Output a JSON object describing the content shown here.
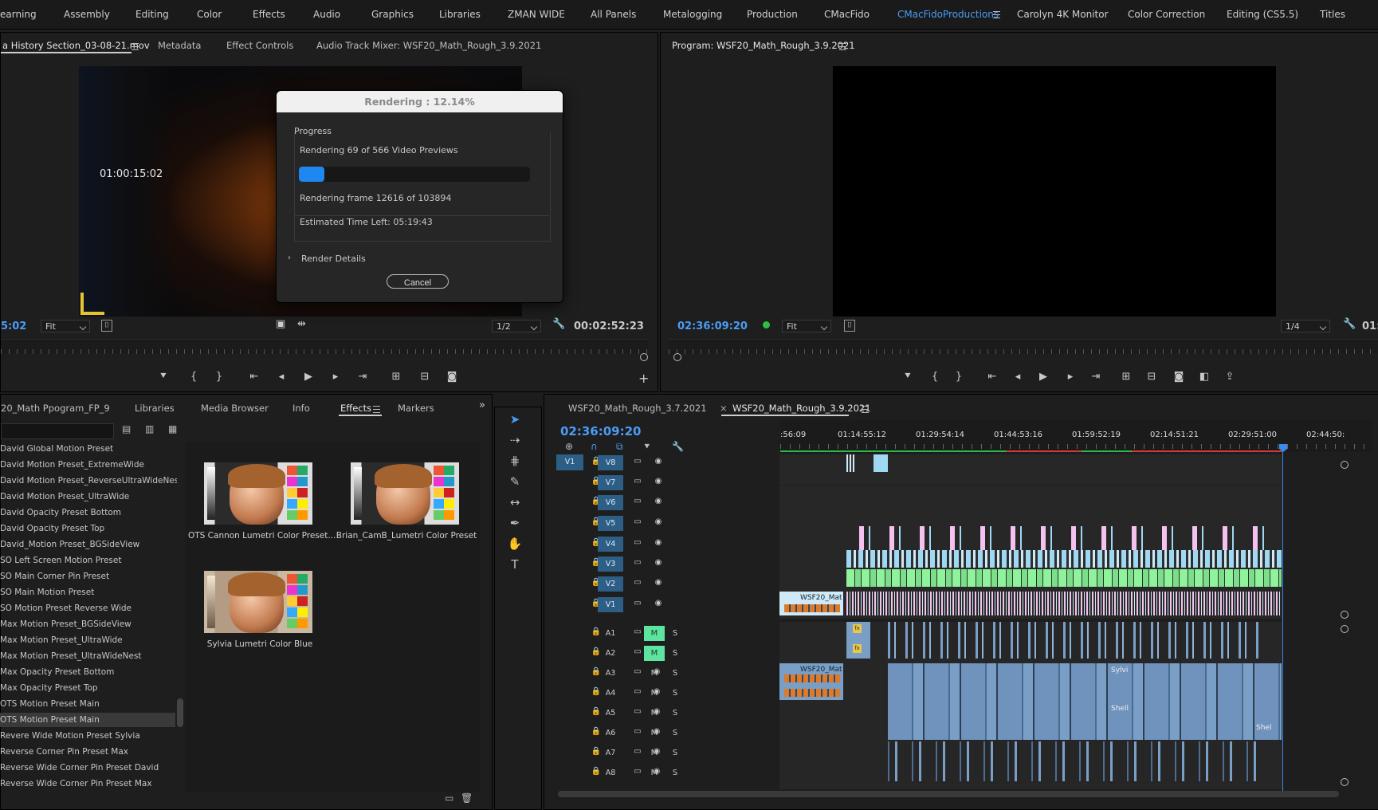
{
  "workspaces": [
    "earning",
    "Assembly",
    "Editing",
    "Color",
    "Effects",
    "Audio",
    "Graphics",
    "Libraries",
    "ZMAN WIDE",
    "All Panels",
    "Metalogging",
    "Production",
    "CMacFido",
    "CMacFidoProductions",
    "Carolyn 4K Monitor",
    "Color Correction",
    "Editing (CS5.5)",
    "Titles"
  ],
  "active_workspace": "CMacFidoProductions",
  "source_panel": {
    "tabs": [
      "a History Section_03-08-21.mov",
      "Metadata",
      "Effect Controls",
      "Audio Track Mixer: WSF20_Math_Rough_3.9.2021"
    ],
    "overlay_timecode": "01:00:15:02",
    "left_timecode": "5:02",
    "fit": "Fit",
    "resolution": "1/2",
    "duration": "00:02:52:23"
  },
  "program_panel": {
    "title": "Program: WSF20_Math_Rough_3.9.2021",
    "timecode": "02:36:09:20",
    "fit": "Fit",
    "resolution": "1/4",
    "right_timecode": "01:"
  },
  "dialog": {
    "title": "Rendering : 12.14%",
    "group_label": "Progress",
    "line1": "Rendering 69 of 566 Video Previews",
    "progress": 0.1214,
    "line2": "Rendering frame 12616 of 103894",
    "line3": "Estimated Time Left: 05:19:43",
    "details": "Render Details",
    "cancel": "Cancel"
  },
  "project_panel": {
    "tabs": [
      "20_Math Ppogram_FP_9",
      "Libraries",
      "Media Browser",
      "Info",
      "Effects",
      "Markers"
    ],
    "active_tab": "Effects",
    "presets": [
      "David Global Motion Preset",
      "David Motion Preset_ExtremeWide",
      "David Motion Preset_ReverseUltraWideNest",
      "David Motion Preset_UltraWide",
      "David Opacity Preset Bottom",
      "David Opacity Preset Top",
      "David_Motion Preset_BGSideView",
      "SO Left Screen Motion Preset",
      "SO Main Corner Pin Preset",
      "SO Main Motion Preset",
      "SO Motion Preset Reverse Wide",
      "Max Motion Preset_BGSideView",
      "Max Motion Preset_UltraWide",
      "Max Motion Preset_UltraWideNest",
      "Max Opacity Preset Bottom",
      "Max Opacity Preset Top",
      "OTS Motion Preset Main",
      "OTS Motion Preset Main",
      "Revere Wide Motion Preset Sylvia",
      "Reverse Corner Pin Preset Max",
      "Reverse Wide Corner Pin Preset David",
      "Reverse Wide Corner Pin Preset Max"
    ],
    "selected_index": 17,
    "thumbnails": [
      "OTS Cannon Lumetri Color Preset...",
      "Brian_CamB_Lumetri Color Preset",
      "Sylvia Lumetri Color Blue"
    ]
  },
  "timeline": {
    "tabs": [
      "WSF20_Math_Rough_3.7.2021",
      "WSF20_Math_Rough_3.9.2021"
    ],
    "timecode": "02:36:09:20",
    "ruler": [
      ":56:09",
      "01:14:55:12",
      "01:29:54:14",
      "01:44:53:16",
      "01:59:52:19",
      "02:14:51:21",
      "02:29:51:00",
      "02:44:50:"
    ],
    "video_tracks": [
      "V8",
      "V7",
      "V6",
      "V5",
      "V4",
      "V3",
      "V2",
      "V1"
    ],
    "audio_tracks": [
      "A1",
      "A2",
      "A3",
      "A4",
      "A5",
      "A6",
      "A7",
      "A8"
    ],
    "source_patch": "V1",
    "clip_label": "WSF20_Mat",
    "audio_clip_labels": [
      "Sylvi",
      "Shell",
      "Shel"
    ],
    "mute_label": "M",
    "solo_label": "S"
  },
  "colors": {
    "accent": "#4a9cf5",
    "progress": "#1e87f0",
    "green": "#5de59f",
    "video_clip": "#cfe9f7",
    "pink": "#f4c2ee",
    "audio_clip": "#7a9fc7"
  }
}
